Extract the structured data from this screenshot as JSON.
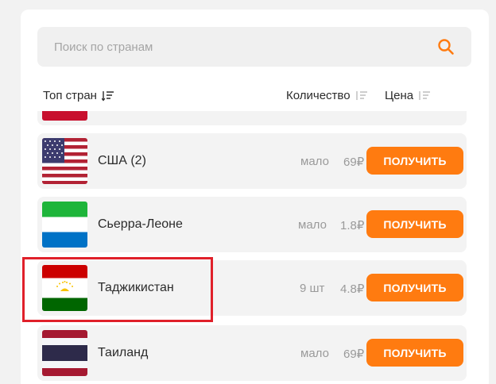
{
  "search": {
    "placeholder": "Поиск по странам"
  },
  "header": {
    "top": "Топ стран",
    "quantity": "Количество",
    "price": "Цена"
  },
  "rows": [
    {
      "country": "США (2)",
      "qty": "мало",
      "price": "69₽",
      "button": "ПОЛУЧИТЬ",
      "flag": "us-flag"
    },
    {
      "country": "Сьерра-Леоне",
      "qty": "мало",
      "price": "1.8₽",
      "button": "ПОЛУЧИТЬ",
      "flag": "sierra-leone-flag"
    },
    {
      "country": "Таджикистан",
      "qty": "9 шт",
      "price": "4.8₽",
      "button": "ПОЛУЧИТЬ",
      "flag": "tajikistan-flag"
    },
    {
      "country": "Таиланд",
      "qty": "мало",
      "price": "69₽",
      "button": "ПОЛУЧИТЬ",
      "flag": "thailand-flag"
    }
  ],
  "colors": {
    "accent": "#ff7b10",
    "highlight": "#e0202a",
    "row_bg": "#f3f3f3"
  }
}
